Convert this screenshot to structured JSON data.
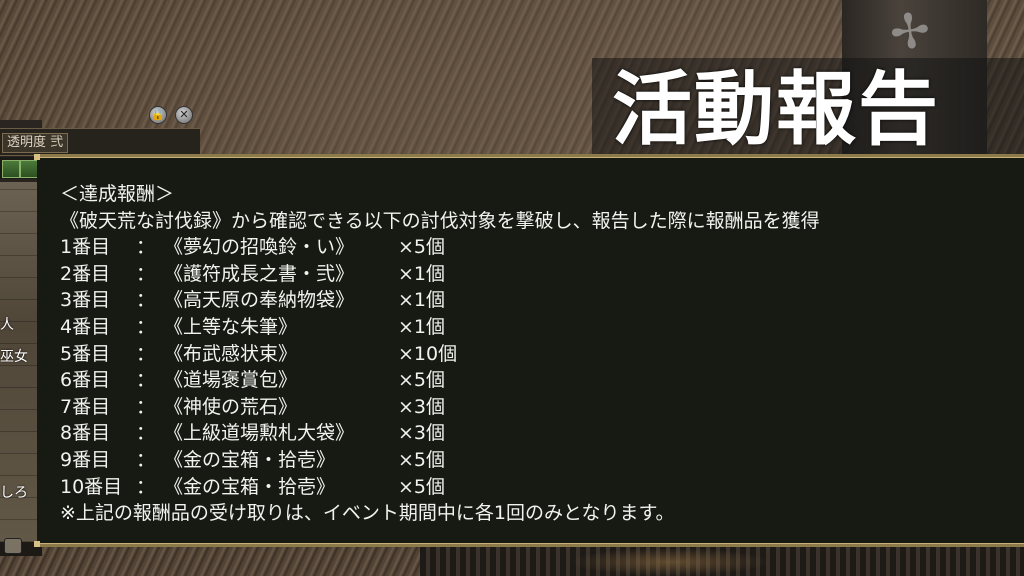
{
  "title": "活動報告",
  "side_panel": {
    "tab_label": "透明度 弐",
    "labels": [
      "人",
      "巫女",
      "しろ"
    ]
  },
  "report": {
    "heading": "＜達成報酬＞",
    "intro": "《破天荒な討伐録》から確認できる以下の討伐対象を撃破し、報告した際に報酬品を獲得",
    "rewards": [
      {
        "rank": "1番目",
        "sep": "：",
        "item": "《夢幻の招喚鈴・い》",
        "qty": "×5個"
      },
      {
        "rank": "2番目",
        "sep": "：",
        "item": "《護符成長之書・弐》",
        "qty": "×1個"
      },
      {
        "rank": "3番目",
        "sep": "：",
        "item": "《高天原の奉納物袋》",
        "qty": "×1個"
      },
      {
        "rank": "4番目",
        "sep": "：",
        "item": "《上等な朱筆》",
        "qty": "×1個"
      },
      {
        "rank": "5番目",
        "sep": "：",
        "item": "《布武感状束》",
        "qty": "×10個"
      },
      {
        "rank": "6番目",
        "sep": "：",
        "item": "《道場褒賞包》",
        "qty": "×5個"
      },
      {
        "rank": "7番目",
        "sep": "：",
        "item": "《神使の荒石》",
        "qty": "×3個"
      },
      {
        "rank": "8番目",
        "sep": "：",
        "item": "《上級道場勲札大袋》",
        "qty": "×3個"
      },
      {
        "rank": "9番目",
        "sep": "：",
        "item": "《金の宝箱・拾壱》",
        "qty": "×5個"
      },
      {
        "rank": "10番目",
        "sep": "：",
        "item": "《金の宝箱・拾壱》",
        "qty": "×5個"
      }
    ],
    "note": "※上記の報酬品の受け取りは、イベント期間中に各1回のみとなります。"
  }
}
